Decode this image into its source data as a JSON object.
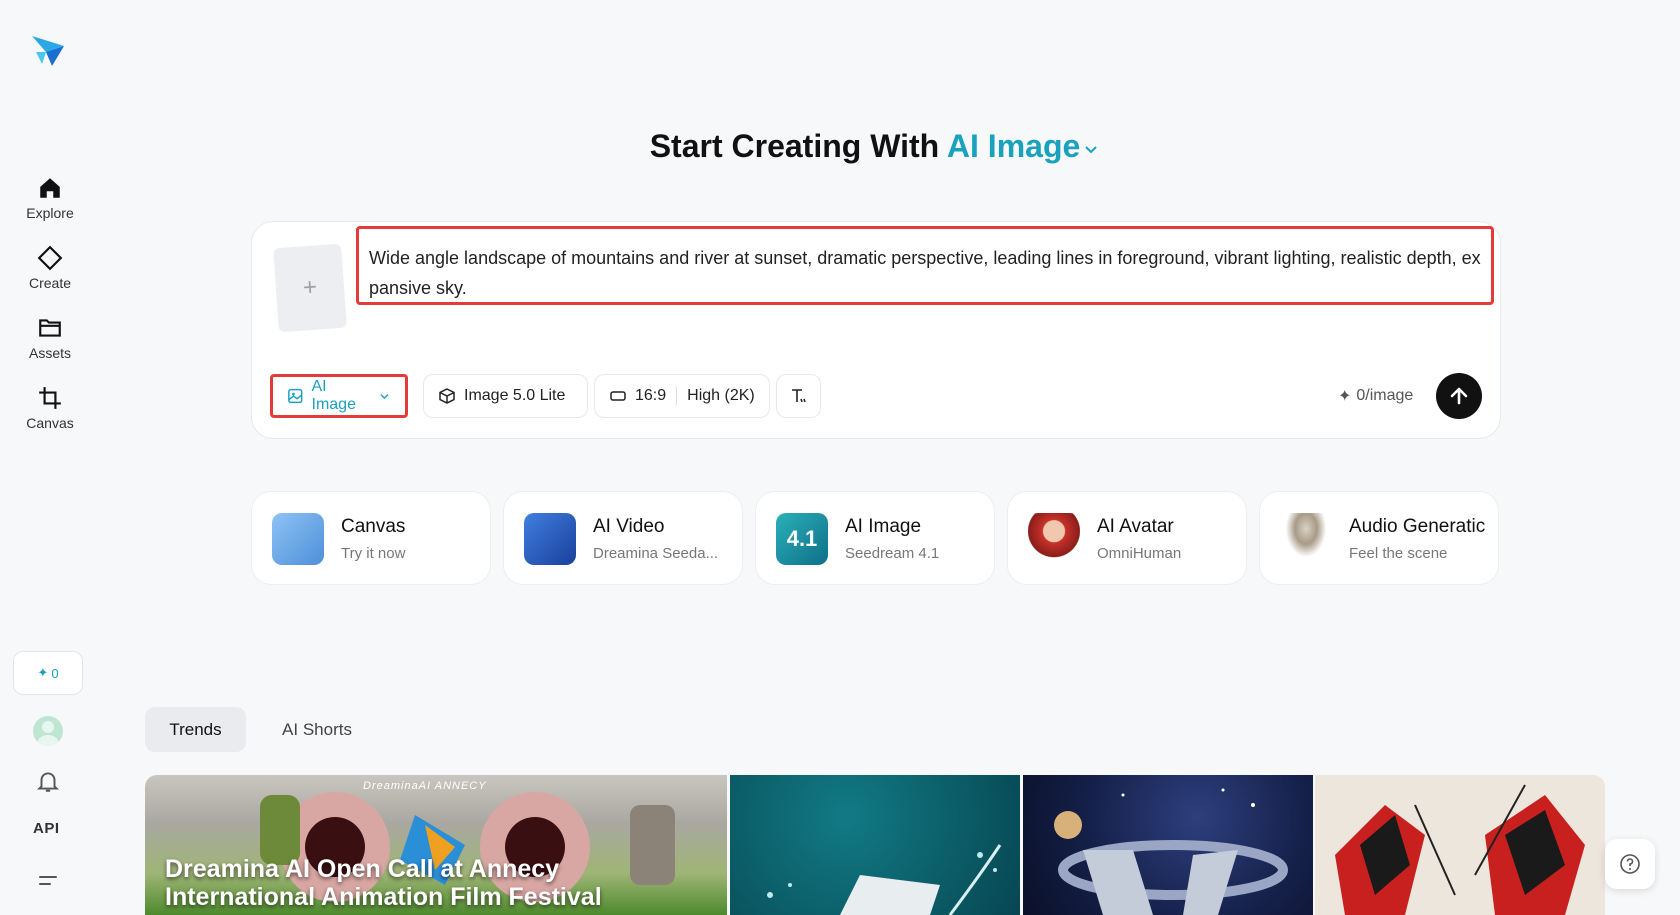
{
  "sidebar": {
    "nav": [
      {
        "label": "Explore",
        "icon": "home-icon"
      },
      {
        "label": "Create",
        "icon": "diamond-icon"
      },
      {
        "label": "Assets",
        "icon": "folder-icon"
      },
      {
        "label": "Canvas",
        "icon": "crop-icon"
      }
    ],
    "credits": "0",
    "api_label": "API"
  },
  "headline": {
    "prefix": "Start Creating With",
    "accent": "AI Image"
  },
  "prompt": {
    "text": "Wide angle landscape of mountains and river at sunset, dramatic perspective, leading lines in foreground, vibrant lighting, realistic depth, expansive sky.",
    "upload_symbol": "+"
  },
  "toolbar": {
    "mode": "AI Image",
    "model": "Image 5.0 Lite",
    "ratio": "16:9",
    "quality": "High (2K)",
    "cost": "0/image"
  },
  "features": [
    {
      "title": "Canvas",
      "subtitle": "Try it now"
    },
    {
      "title": "AI Video",
      "subtitle": "Dreamina Seeda..."
    },
    {
      "title": "AI Image",
      "subtitle": "Seedream 4.1",
      "badge": "4.1"
    },
    {
      "title": "AI Avatar",
      "subtitle": "OmniHuman"
    },
    {
      "title": "Audio Generatic",
      "subtitle": "Feel the scene"
    }
  ],
  "tabs": {
    "active": "Trends",
    "inactive": "AI Shorts"
  },
  "gallery": {
    "featured_title_line1": "Dreamina AI Open Call at Annecy",
    "featured_title_line2": "International Animation Film Festival",
    "brand": "DreaminaAI   ANNECY"
  },
  "colors": {
    "accent": "#1aa1be",
    "highlight_border": "#e53a3a"
  }
}
